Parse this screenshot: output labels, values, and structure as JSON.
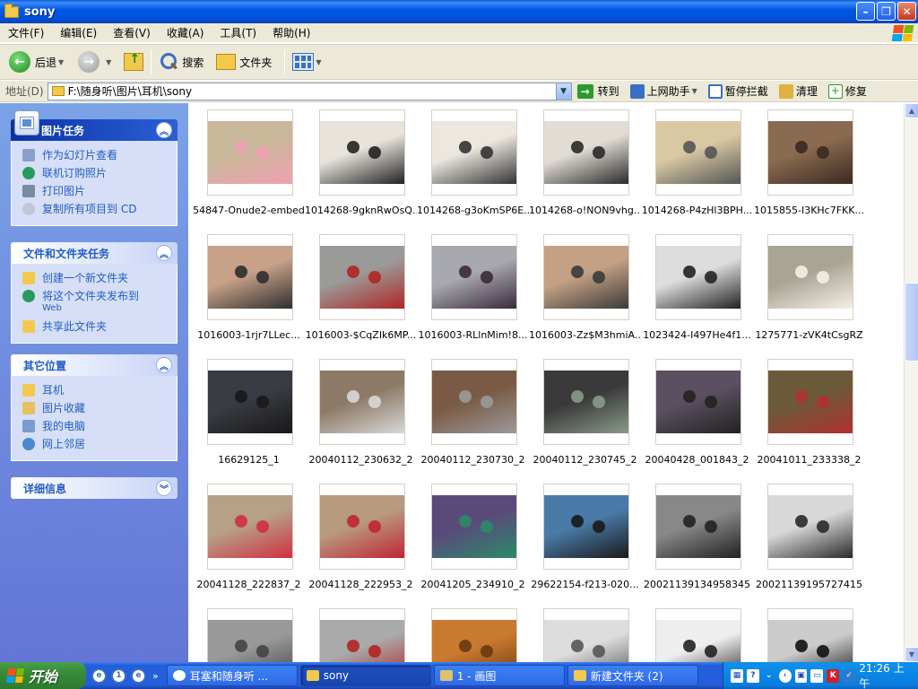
{
  "window": {
    "title": "sony"
  },
  "menu": [
    "文件(F)",
    "编辑(E)",
    "查看(V)",
    "收藏(A)",
    "工具(T)",
    "帮助(H)"
  ],
  "toolbar": {
    "back": "后退",
    "search": "搜索",
    "folders": "文件夹"
  },
  "address": {
    "label": "地址(D)",
    "path": "F:\\随身听\\图片\\耳机\\sony",
    "go": "转到",
    "tools": [
      "上网助手",
      "暂停拦截",
      "清理",
      "修复"
    ]
  },
  "taskpane": {
    "picture_tasks": {
      "title": "图片任务",
      "items": [
        "作为幻灯片查看",
        "联机订购照片",
        "打印图片",
        "复制所有项目到 CD"
      ]
    },
    "file_tasks": {
      "title": "文件和文件夹任务",
      "items": [
        "创建一个新文件夹",
        "将这个文件夹发布到",
        "共享此文件夹"
      ],
      "item2_sub": "Web"
    },
    "other_places": {
      "title": "其它位置",
      "items": [
        "耳机",
        "图片收藏",
        "我的电脑",
        "网上邻居"
      ]
    },
    "details": {
      "title": "详细信息"
    }
  },
  "files": [
    "54847-Onude2-embed",
    "1014268-9gknRwOsQ...",
    "1014268-g3oKmSP6E...",
    "1014268-o!NON9vhg...",
    "1014268-P4zHl3BPH...",
    "1015855-I3KHc7FKK...",
    "1016003-1rjr7LLec...",
    "1016003-$CqZIk6MP...",
    "1016003-RLlnMim!8...",
    "1016003-Zz$M3hmiA...",
    "1023424-I497He4f1...",
    "1275771-zVK4tCsgRZ",
    "16629125_1",
    "20040112_230632_2",
    "20040112_230730_2",
    "20040112_230745_2",
    "20040428_001843_2",
    "20041011_233338_2",
    "20041128_222837_2",
    "20041128_222953_2",
    "20041205_234910_2",
    "29622154-f213-020...",
    "20021139134958345",
    "20021139195727415",
    "",
    "",
    "",
    "",
    "",
    ""
  ],
  "thumb_colors": [
    [
      "#c9b79a",
      "#f0a0b0"
    ],
    [
      "#e8e4dc",
      "#222"
    ],
    [
      "#ece8df",
      "#333"
    ],
    [
      "#e2ddd4",
      "#2a2a2a"
    ],
    [
      "#d9c9a3",
      "#555"
    ],
    [
      "#8a6a50",
      "#3a2a20"
    ],
    [
      "#c7a188",
      "#2e2e2e"
    ],
    [
      "#9a9a98",
      "#b02525"
    ],
    [
      "#a8a8b0",
      "#3a2a3a"
    ],
    [
      "#c4a184",
      "#3a3a3a"
    ],
    [
      "#ddd",
      "#222"
    ],
    [
      "#aaa494",
      "#f4f0e4"
    ],
    [
      "#3a3c44",
      "#181818"
    ],
    [
      "#8d7a66",
      "#d8d8d8"
    ],
    [
      "#7a5a44",
      "#9a9a9a"
    ],
    [
      "#3a3a3a",
      "#8a9a8a"
    ],
    [
      "#5a5060",
      "#222"
    ],
    [
      "#6b5a3a",
      "#b03030"
    ],
    [
      "#b6a088",
      "#d03040"
    ],
    [
      "#b89a80",
      "#c02535"
    ],
    [
      "#5a4a7a",
      "#2a8a6a"
    ],
    [
      "#4a7aa8",
      "#1a1a1a"
    ],
    [
      "#888",
      "#222"
    ],
    [
      "#d8d8d8",
      "#2a2a2a"
    ],
    [
      "#999",
      "#444"
    ],
    [
      "#aaa",
      "#b02525"
    ],
    [
      "#c87a30",
      "#6a3a10"
    ],
    [
      "#ddd",
      "#555"
    ],
    [
      "#eee",
      "#222"
    ],
    [
      "#ccc",
      "#111"
    ]
  ],
  "taskbar": {
    "start": "开始",
    "buttons": [
      "耳塞和随身听 ...",
      "sony",
      "1 - 画图",
      "新建文件夹 (2)"
    ],
    "clock": "21:26 上午"
  }
}
